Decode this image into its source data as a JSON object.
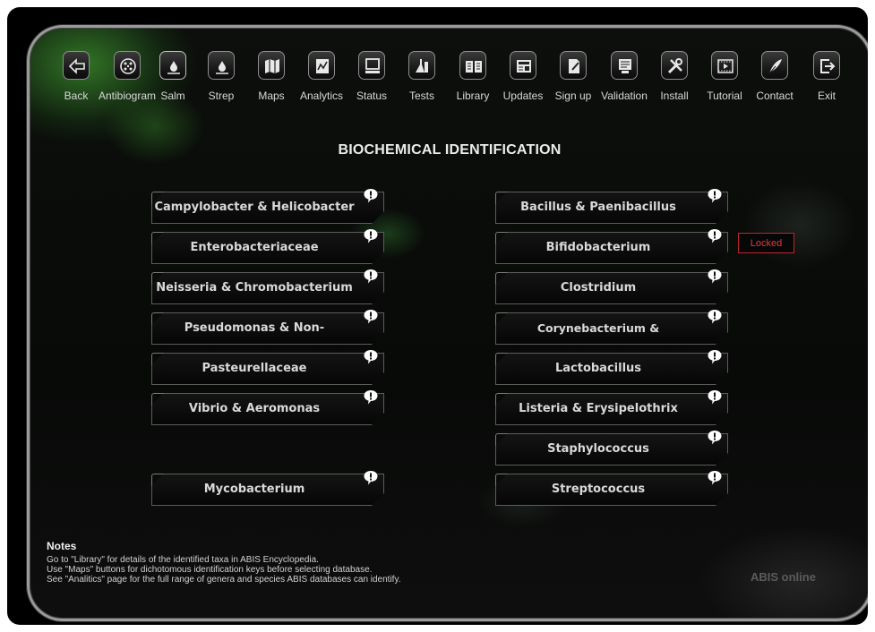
{
  "toolbar": {
    "items": [
      {
        "label": "Back",
        "icon": "arrow-left-icon"
      },
      {
        "label": "Antibiogram",
        "icon": "petri-dish-icon"
      },
      {
        "label": "Salm",
        "icon": "drop-icon"
      },
      {
        "label": "Strep",
        "icon": "drop-icon"
      },
      {
        "label": "Maps",
        "icon": "map-icon"
      },
      {
        "label": "Analytics",
        "icon": "chart-icon"
      },
      {
        "label": "Status",
        "icon": "monitor-icon"
      },
      {
        "label": "Tests",
        "icon": "flask-icon"
      },
      {
        "label": "Library",
        "icon": "book-icon"
      },
      {
        "label": "Updates",
        "icon": "news-icon"
      },
      {
        "label": "Sign up",
        "icon": "signup-icon"
      },
      {
        "label": "Validation",
        "icon": "validation-icon"
      },
      {
        "label": "Install",
        "icon": "tools-icon"
      },
      {
        "label": "Tutorial",
        "icon": "film-icon"
      },
      {
        "label": "Contact",
        "icon": "feather-icon"
      },
      {
        "label": "Exit",
        "icon": "exit-icon"
      }
    ]
  },
  "page_title": "BIOCHEMICAL IDENTIFICATION",
  "left_databases": [
    "Campylobacter & Helicobacter",
    "Enterobacteriaceae",
    "Neisseria & Chromobacterium",
    "Pseudomonas & Non-fermenters",
    "Pasteurellaceae",
    "Vibrio & Aeromonas",
    "Mycobacterium"
  ],
  "right_databases": [
    "Bacillus & Paenibacillus",
    "Bifidobacterium",
    "Clostridium",
    "Corynebacterium & Actinomyces",
    "Lactobacillus",
    "Listeria & Erysipelothrix",
    "Staphylococcus",
    "Streptococcus"
  ],
  "locked_badge": "Locked",
  "notes": {
    "heading": "Notes",
    "lines": [
      "Go to \"Library\" for details of the identified taxa in ABIS Encyclopedia.",
      "Use \"Maps\" buttons for dichotomous identification keys before selecting database.",
      "See \"Analitics\" page for the full range of genera and species ABIS databases can identify."
    ]
  },
  "brand": "ABIS online",
  "colors": {
    "locked": "#e23a3a",
    "background": "#000000",
    "text": "#d9d9d9"
  }
}
